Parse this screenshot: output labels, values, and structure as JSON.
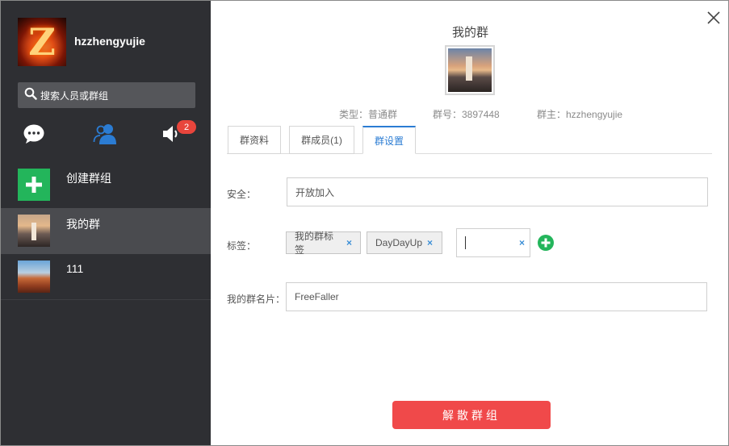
{
  "user": {
    "name": "hzzhengyujie",
    "avatar_letter": "Z"
  },
  "search": {
    "placeholder": "搜索人员或群组"
  },
  "nav": {
    "chat_icon": "chat-bubble-icon",
    "contacts_icon": "contacts-icon",
    "notify_icon": "speaker-icon",
    "notify_badge": "2"
  },
  "sidebar": {
    "create_label": "创建群组",
    "groups": [
      {
        "label": "我的群",
        "selected": true
      },
      {
        "label": "111",
        "selected": false
      }
    ]
  },
  "group": {
    "title": "我的群",
    "type_text": "类型：普通群",
    "id_text": "群号：3897448",
    "owner_text": "群主：hzzhengyujie"
  },
  "tabs": [
    {
      "label": "群资料",
      "active": false
    },
    {
      "label": "群成员(1)",
      "active": false
    },
    {
      "label": "群设置",
      "active": true
    }
  ],
  "settings": {
    "security_label": "安全：",
    "security_value": "开放加入",
    "tags_label": "标签：",
    "tags": [
      "我的群标签",
      "DayDayUp"
    ],
    "tag_remove_glyph": "×",
    "tag_input_value": "",
    "card_label": "我的群名片：",
    "card_value": "FreeFaller"
  },
  "actions": {
    "dissolve_label": "解散群组"
  },
  "colors": {
    "sidebar_bg": "#2e2f33",
    "selected_row": "#4a4b4f",
    "accent_blue": "#2b7cd3",
    "green": "#23b55b",
    "danger": "#f0494a",
    "badge": "#e8453c"
  }
}
